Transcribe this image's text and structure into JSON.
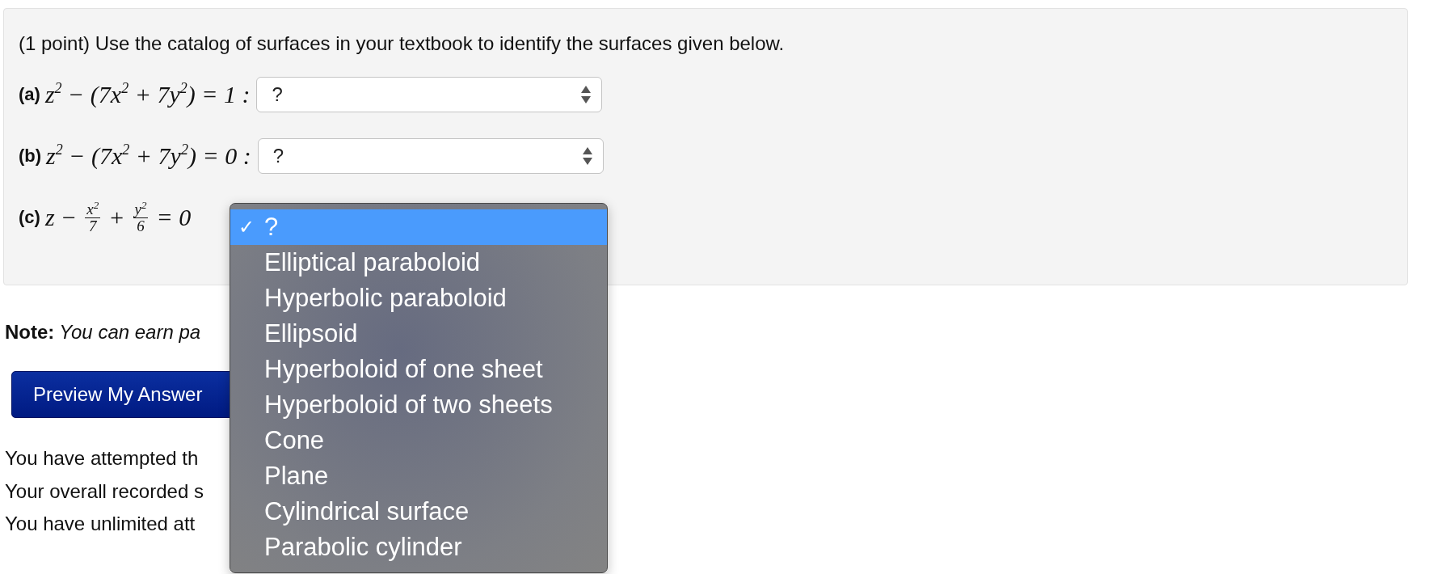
{
  "problem": {
    "header": "(1 point) Use the catalog of surfaces in your textbook to identify the surfaces given below.",
    "parts": [
      {
        "label": "(a)",
        "equation": [
          {
            "kind": "text",
            "text": "z$^{2}$ − (7x$^{2}$ + 7y$^{2}$) = 1 :"
          }
        ],
        "answer": {
          "value": "?"
        }
      },
      {
        "label": "(b)",
        "equation": [
          {
            "kind": "text",
            "text": "z$^{2}$ − (7x$^{2}$ + 7y$^{2}$) = 0 :"
          }
        ],
        "answer": {
          "value": "?"
        }
      },
      {
        "label": "(c)",
        "equation": [
          {
            "kind": "text",
            "text": "z −"
          },
          {
            "kind": "frac",
            "num": "x$^{2}$",
            "den": "7"
          },
          {
            "kind": "text",
            "text": "+"
          },
          {
            "kind": "frac",
            "num": "y$^{2}$",
            "den": "6"
          },
          {
            "kind": "text",
            "text": "= 0"
          }
        ]
      }
    ]
  },
  "dropdown": {
    "check_mark": "✓",
    "options": [
      {
        "label": "?",
        "selected": true
      },
      {
        "label": "Elliptical paraboloid",
        "selected": false
      },
      {
        "label": "Hyperbolic paraboloid",
        "selected": false
      },
      {
        "label": "Ellipsoid",
        "selected": false
      },
      {
        "label": "Hyperboloid of one sheet",
        "selected": false
      },
      {
        "label": "Hyperboloid of two sheets",
        "selected": false
      },
      {
        "label": "Cone",
        "selected": false
      },
      {
        "label": "Plane",
        "selected": false
      },
      {
        "label": "Cylindrical surface",
        "selected": false
      },
      {
        "label": "Parabolic cylinder",
        "selected": false
      }
    ]
  },
  "note": {
    "label": "Note:",
    "text": "You can earn pa"
  },
  "preview_button": "Preview My Answer",
  "status_lines": [
    "You have attempted th",
    "Your overall recorded s",
    "You have unlimited att"
  ]
}
